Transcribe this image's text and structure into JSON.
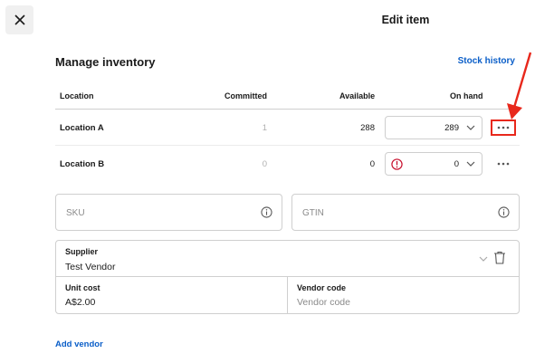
{
  "header": {
    "close_icon": "close-icon",
    "title": "Edit item"
  },
  "inventory": {
    "title": "Manage inventory",
    "stock_history_label": "Stock history",
    "columns": [
      "Location",
      "Committed",
      "Available",
      "On hand"
    ],
    "rows": [
      {
        "location": "Location A",
        "committed": "1",
        "available": "288",
        "on_hand": "289",
        "warning": false
      },
      {
        "location": "Location B",
        "committed": "0",
        "available": "0",
        "on_hand": "0",
        "warning": true
      }
    ]
  },
  "fields": {
    "sku_placeholder": "SKU",
    "gtin_placeholder": "GTIN"
  },
  "supplier": {
    "supplier_label": "Supplier",
    "supplier_value": "Test Vendor",
    "unit_cost_label": "Unit cost",
    "unit_cost_value": "A$2.00",
    "vendor_code_label": "Vendor code",
    "vendor_code_placeholder": "Vendor code"
  },
  "add_vendor_label": "Add vendor",
  "colors": {
    "link": "#0a5ec8",
    "annotation": "#e8281c",
    "warning": "#c8102e"
  }
}
